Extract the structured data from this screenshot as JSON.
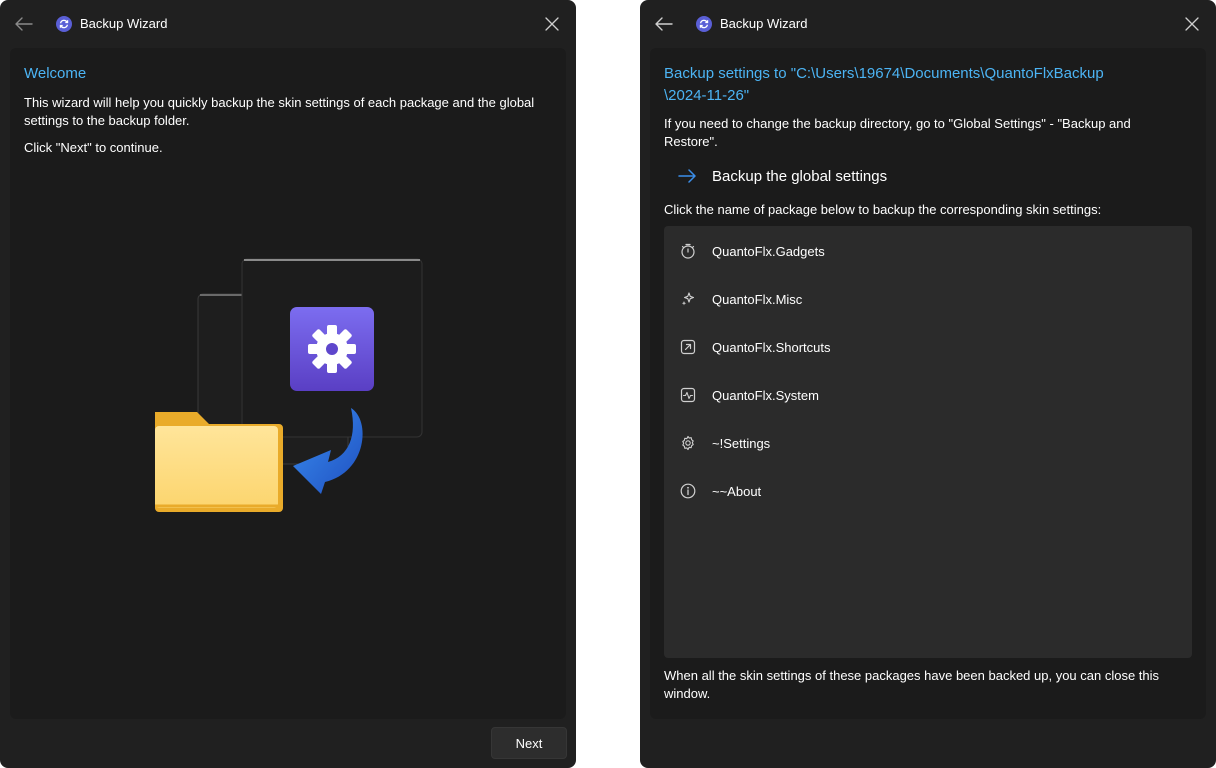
{
  "left_window": {
    "title": "Backup Wizard",
    "heading": "Welcome",
    "intro_line1": "This wizard will help you quickly backup the skin settings of each package and the global",
    "intro_line2": "settings to the backup folder.",
    "continue_text": "Click \"Next\" to continue.",
    "next_label": "Next"
  },
  "right_window": {
    "title": "Backup Wizard",
    "heading_line1": "Backup settings to \"C:\\Users\\19674\\Documents\\QuantoFlxBackup",
    "heading_line2": "\\2024-11-26\"",
    "hint_line1": "If you need to change the backup directory, go to \"Global Settings\" - \"Backup and",
    "hint_line2": "Restore\".",
    "global_backup_label": "Backup the global settings",
    "list_intro": "Click the name of package below to backup the corresponding skin settings:",
    "packages": [
      {
        "name": "QuantoFlx.Gadgets",
        "icon": "timer-icon"
      },
      {
        "name": "QuantoFlx.Misc",
        "icon": "sparkle-icon"
      },
      {
        "name": "QuantoFlx.Shortcuts",
        "icon": "open-link-icon"
      },
      {
        "name": "QuantoFlx.System",
        "icon": "pulse-icon"
      },
      {
        "name": "~!Settings",
        "icon": "gear-icon"
      },
      {
        "name": "~~About",
        "icon": "info-icon"
      }
    ],
    "footer_line1": "When all the skin settings of these packages have been backed up, you can close this",
    "footer_line2": "window."
  },
  "colors": {
    "window_bg": "#202020",
    "card_bg": "#1b1b1b",
    "list_bg": "#2b2b2b",
    "accent": "#4cb4f4",
    "arrow": "#3b8eea"
  }
}
